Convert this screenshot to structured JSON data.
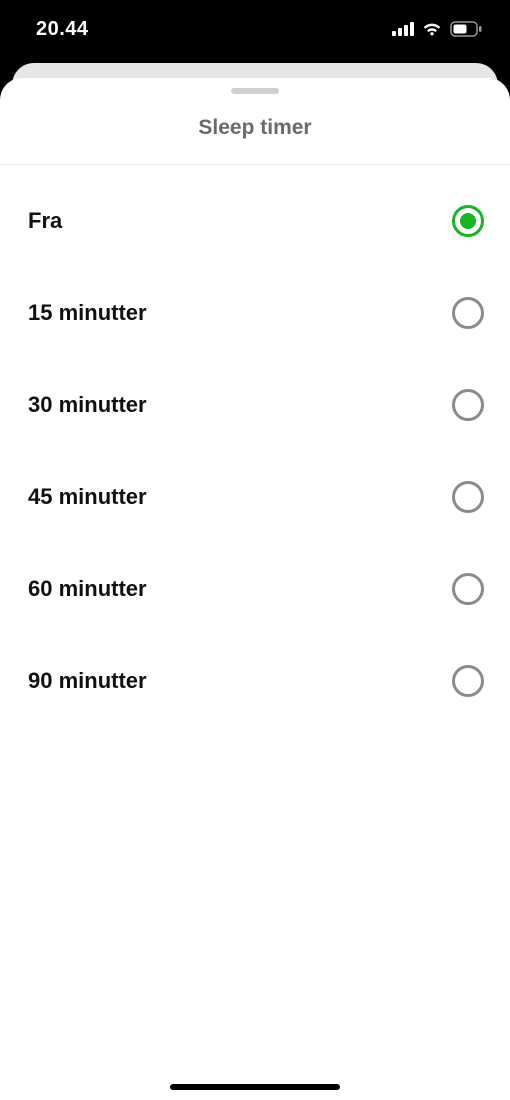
{
  "status": {
    "time": "20.44"
  },
  "sheet": {
    "title": "Sleep timer",
    "options": [
      {
        "label": "Fra",
        "selected": true
      },
      {
        "label": "15 minutter",
        "selected": false
      },
      {
        "label": "30 minutter",
        "selected": false
      },
      {
        "label": "45 minutter",
        "selected": false
      },
      {
        "label": "60 minutter",
        "selected": false
      },
      {
        "label": "90 minutter",
        "selected": false
      }
    ]
  }
}
